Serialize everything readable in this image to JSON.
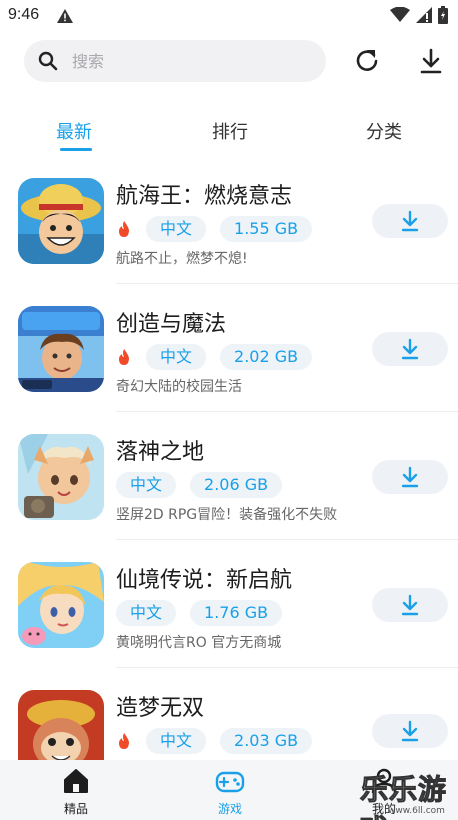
{
  "status_bar": {
    "time": "9:46"
  },
  "search": {
    "placeholder": "搜索"
  },
  "tabs": [
    {
      "label": "最新",
      "active": true
    },
    {
      "label": "排行",
      "active": false
    },
    {
      "label": "分类",
      "active": false
    }
  ],
  "apps": [
    {
      "title": "航海王：燃烧意志",
      "hot": true,
      "lang": "中文",
      "size": "1.55 GB",
      "desc": "航路不止，燃梦不熄!"
    },
    {
      "title": "创造与魔法",
      "hot": true,
      "lang": "中文",
      "size": "2.02 GB",
      "desc": "奇幻大陆的校园生活"
    },
    {
      "title": "落神之地",
      "hot": false,
      "lang": "中文",
      "size": "2.06 GB",
      "desc": "竖屏2D RPG冒险！装备强化不失败"
    },
    {
      "title": "仙境传说：新启航",
      "hot": false,
      "lang": "中文",
      "size": "1.76 GB",
      "desc": "黄哓明代言RO 官方无商城"
    },
    {
      "title": "造梦无双",
      "hot": true,
      "lang": "中文",
      "size": "2.03 GB",
      "desc": ""
    }
  ],
  "bottom_nav": [
    {
      "label": "精品",
      "active": false
    },
    {
      "label": "游戏",
      "active": true
    },
    {
      "label": "我的",
      "active": false
    }
  ],
  "watermark": {
    "text": "乐乐游戏",
    "url": "www.6ll.com"
  },
  "colors": {
    "accent": "#1aa0e8",
    "hot": "#f04a2a",
    "tag_bg": "#eef3f8"
  }
}
